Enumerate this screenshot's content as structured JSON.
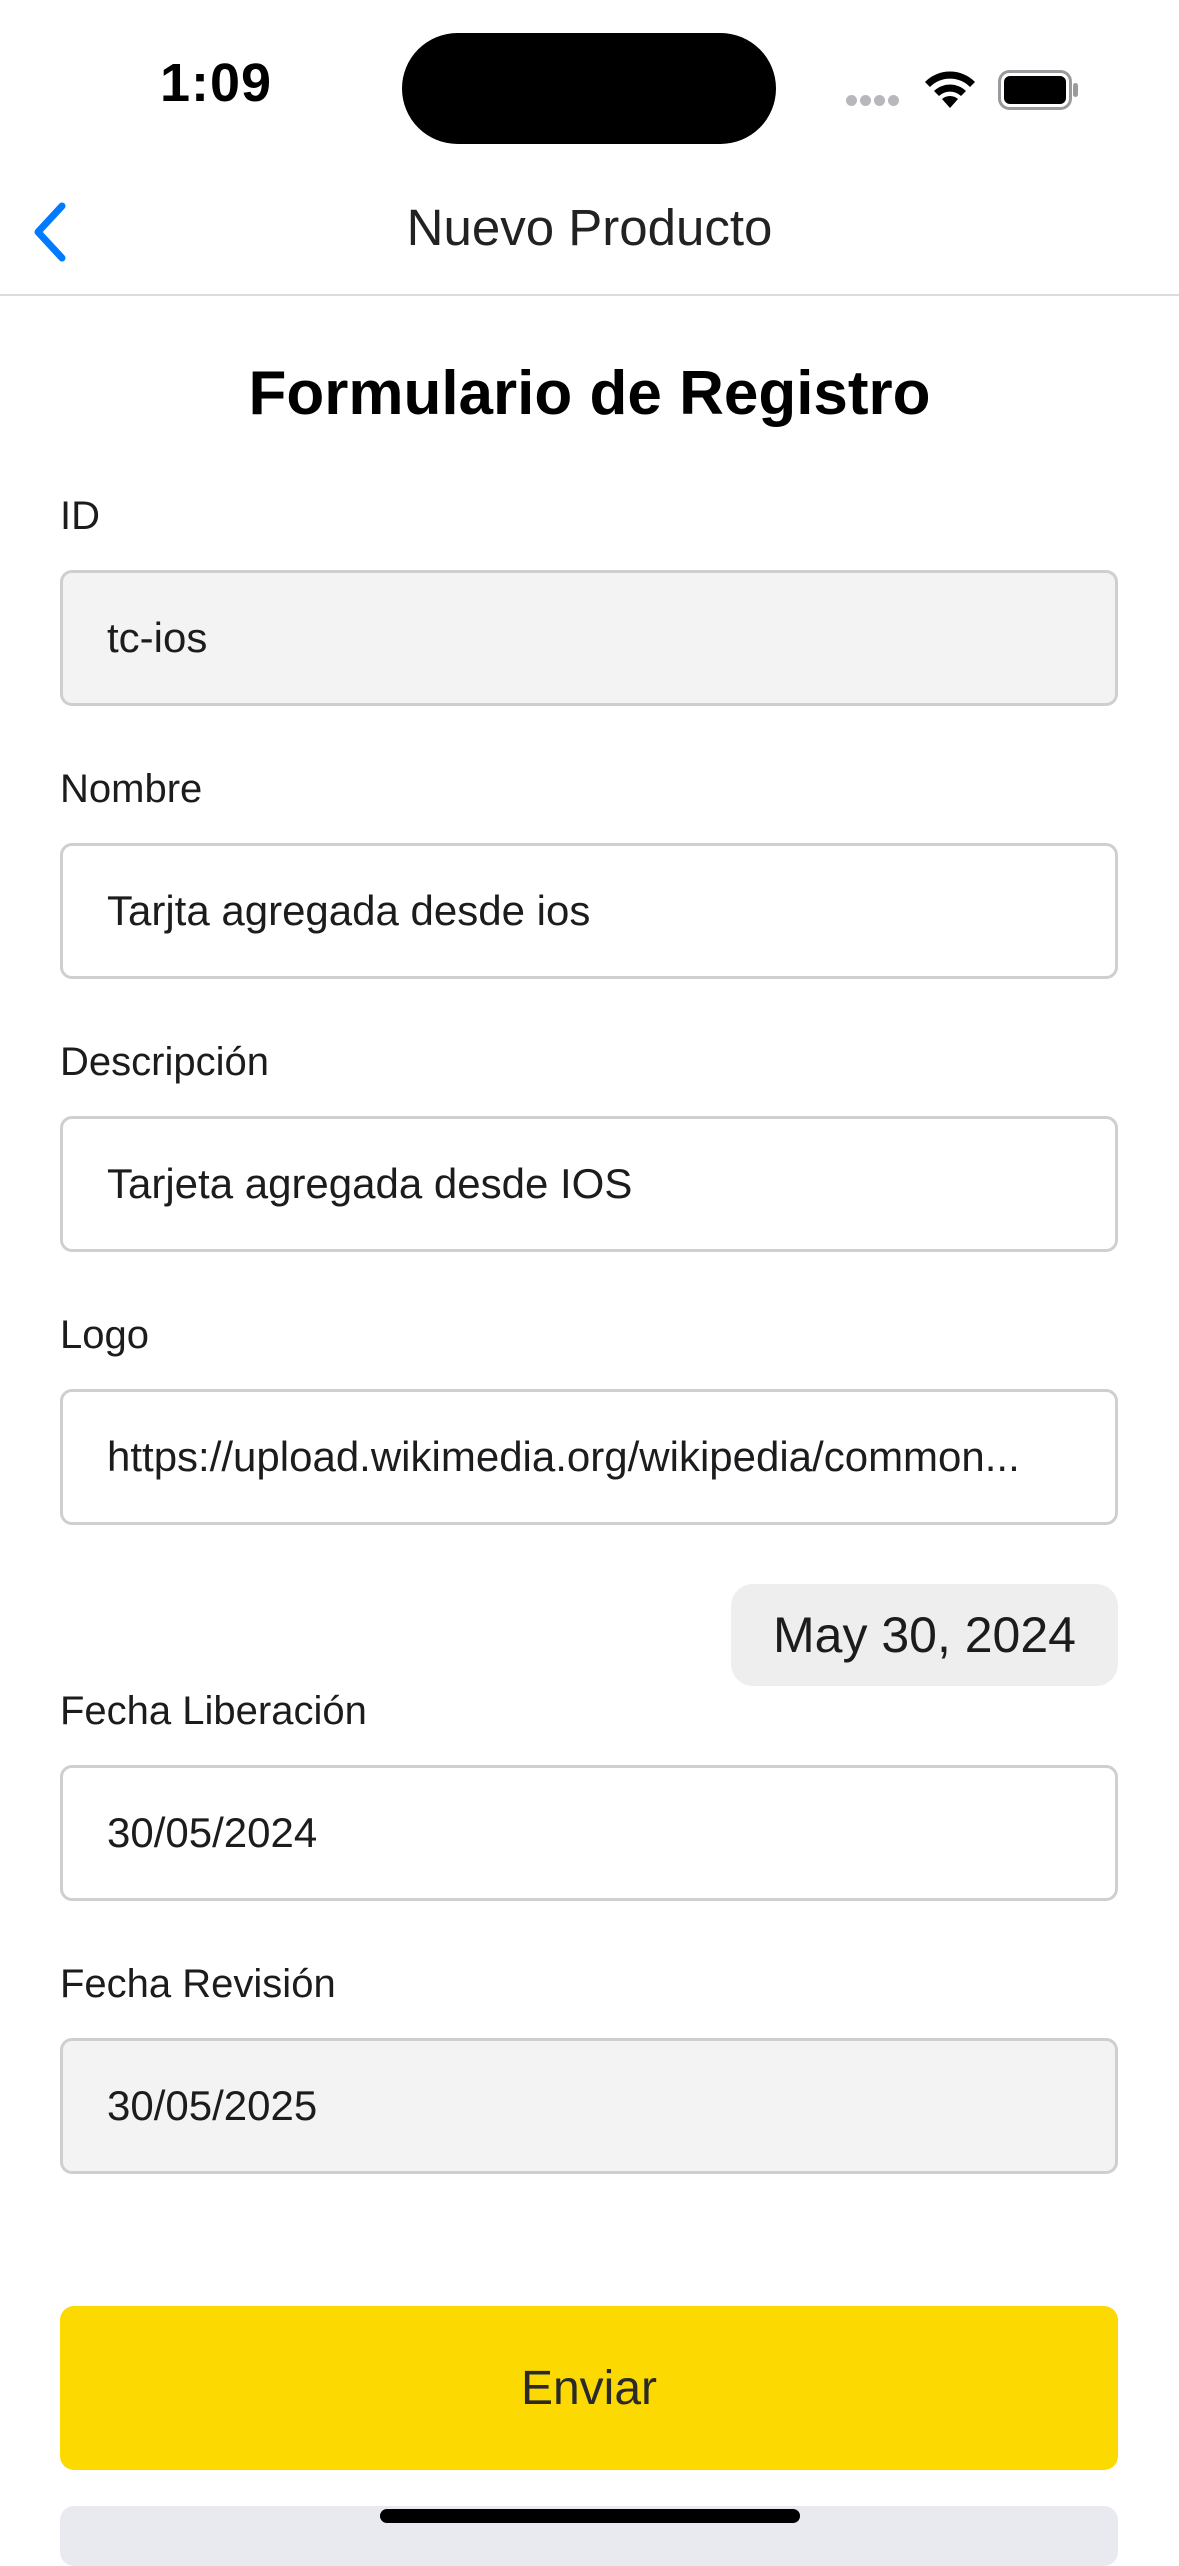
{
  "status_bar": {
    "time": "1:09"
  },
  "nav": {
    "title": "Nuevo Producto"
  },
  "form": {
    "title": "Formulario de Registro",
    "fields": [
      {
        "label": "ID",
        "value": "tc-ios"
      },
      {
        "label": "Nombre",
        "value": "Tarjta agregada desde ios"
      },
      {
        "label": "Descripción",
        "value": "Tarjeta agregada desde IOS"
      },
      {
        "label": "Logo",
        "value": "https://upload.wikimedia.org/wikipedia/common..."
      },
      {
        "label": "Fecha Liberación",
        "value": "30/05/2024"
      },
      {
        "label": "Fecha Revisión",
        "value": "30/05/2025"
      }
    ],
    "date_picker_value": "May 30, 2024",
    "submit_label": "Enviar"
  },
  "colors": {
    "accent": "#007AFF",
    "submit": "#FCD900"
  }
}
